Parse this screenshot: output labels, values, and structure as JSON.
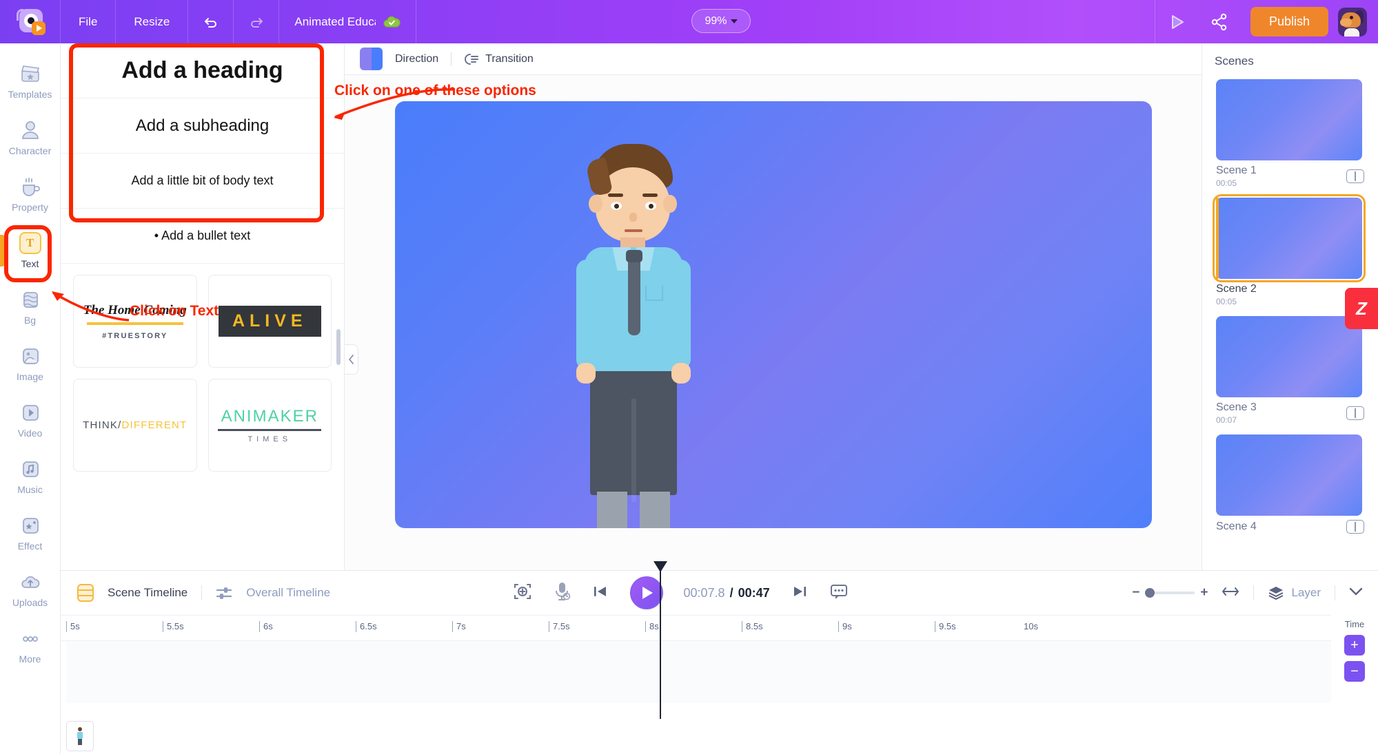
{
  "topbar": {
    "logo_name": "animaker-logo",
    "menu": [
      {
        "label": "File",
        "name": "menu-file"
      },
      {
        "label": "Resize",
        "name": "menu-resize"
      }
    ],
    "undo_label": "Undo",
    "redo_label": "Redo",
    "project_title": "Animated Educa",
    "save_status": "saved-to-cloud",
    "zoom_level": "99%",
    "preview_label": "Preview",
    "share_label": "Share",
    "publish_label": "Publish",
    "avatar_label": "User account",
    "accent_purple": "#8b3ff5",
    "accent_orange": "#f0862b"
  },
  "sidebar": {
    "items": [
      {
        "label": "Templates",
        "icon": "clapperboard-icon",
        "active": false
      },
      {
        "label": "Character",
        "icon": "person-icon",
        "active": false
      },
      {
        "label": "Property",
        "icon": "cup-icon",
        "active": false
      },
      {
        "label": "Text",
        "icon": "text-t-icon",
        "active": true
      },
      {
        "label": "Bg",
        "icon": "layers-bg-icon",
        "active": false
      },
      {
        "label": "Image",
        "icon": "photo-icon",
        "active": false
      },
      {
        "label": "Video",
        "icon": "play-square-icon",
        "active": false
      },
      {
        "label": "Music",
        "icon": "music-note-icon",
        "active": false
      },
      {
        "label": "Effect",
        "icon": "sparkle-icon",
        "active": false
      },
      {
        "label": "Uploads",
        "icon": "cloud-upload-icon",
        "active": false
      },
      {
        "label": "More",
        "icon": "ellipsis-icon",
        "active": false
      }
    ]
  },
  "text_panel": {
    "options": [
      {
        "label": "Add a heading",
        "style": "heading"
      },
      {
        "label": "Add a subheading",
        "style": "subheading"
      },
      {
        "label": "Add a little bit of body text",
        "style": "body"
      },
      {
        "label": "• Add a bullet text",
        "style": "bullet"
      }
    ],
    "templates": [
      {
        "name": "the-home-coming",
        "title": "The Home Coming",
        "sub": "#TRUESTORY"
      },
      {
        "name": "alive",
        "title": "ALIVE",
        "sub": ""
      },
      {
        "name": "think-different",
        "title_a": "THINK/",
        "title_b": "DIFFERENT",
        "sub": ""
      },
      {
        "name": "animaker-times",
        "title": "ANIMAKER",
        "sub": "TIMES"
      }
    ]
  },
  "annotations": [
    {
      "text": "Click on one of these options",
      "name": "annotation-options"
    },
    {
      "text": "Click on Text",
      "name": "annotation-text"
    }
  ],
  "canvas_toolbar": {
    "color_label": "Scene color",
    "direction_label": "Direction",
    "transition_label": "Transition"
  },
  "scenes": {
    "title": "Scenes",
    "items": [
      {
        "label": "Scene 1",
        "duration": "00:05",
        "selected": false,
        "has_link": true
      },
      {
        "label": "Scene 2",
        "duration": "00:05",
        "selected": true,
        "has_link": true
      },
      {
        "label": "Scene 3",
        "duration": "00:07",
        "selected": false,
        "has_link": true
      },
      {
        "label": "Scene 4",
        "duration": "",
        "selected": false,
        "has_link": true
      }
    ],
    "side_tab_label": "Z"
  },
  "timeline": {
    "scene_timeline_label": "Scene Timeline",
    "overall_timeline_label": "Overall Timeline",
    "fit_label": "Fit to screen",
    "mic_label": "Record voice",
    "prev_label": "Previous",
    "play_label": "Play",
    "next_label": "Next",
    "caption_label": "Captions",
    "current_time": "00:07.8",
    "separator": "/",
    "total_time": "00:47",
    "zoom_minus": "−",
    "zoom_plus": "+",
    "fit_width_label": "Fit width",
    "layer_label": "Layer",
    "collapse_label": "Collapse",
    "time_column_label": "Time",
    "time_add": "+",
    "time_remove": "−",
    "ruler_ticks": [
      "5s",
      "5.5s",
      "6s",
      "6.5s",
      "7s",
      "7.5s",
      "8s",
      "8.5s",
      "9s",
      "9.5s",
      "10s"
    ]
  }
}
